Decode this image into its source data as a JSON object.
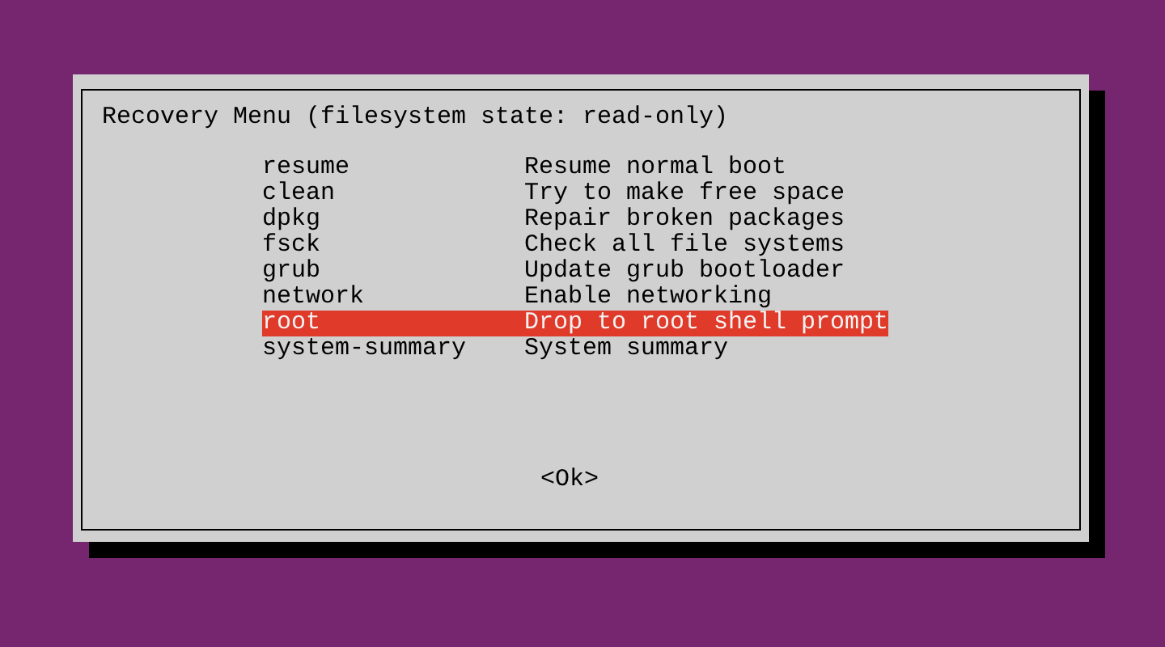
{
  "dialog": {
    "title": "Recovery Menu (filesystem state: read-only)",
    "items": [
      {
        "name": "resume",
        "description": "Resume normal boot",
        "selected": false
      },
      {
        "name": "clean",
        "description": "Try to make free space",
        "selected": false
      },
      {
        "name": "dpkg",
        "description": "Repair broken packages",
        "selected": false
      },
      {
        "name": "fsck",
        "description": "Check all file systems",
        "selected": false
      },
      {
        "name": "grub",
        "description": "Update grub bootloader",
        "selected": false
      },
      {
        "name": "network",
        "description": "Enable networking",
        "selected": false
      },
      {
        "name": "root",
        "description": "Drop to root shell prompt",
        "selected": true
      },
      {
        "name": "system-summary",
        "description": "System summary",
        "selected": false
      }
    ],
    "button": "<Ok>"
  }
}
